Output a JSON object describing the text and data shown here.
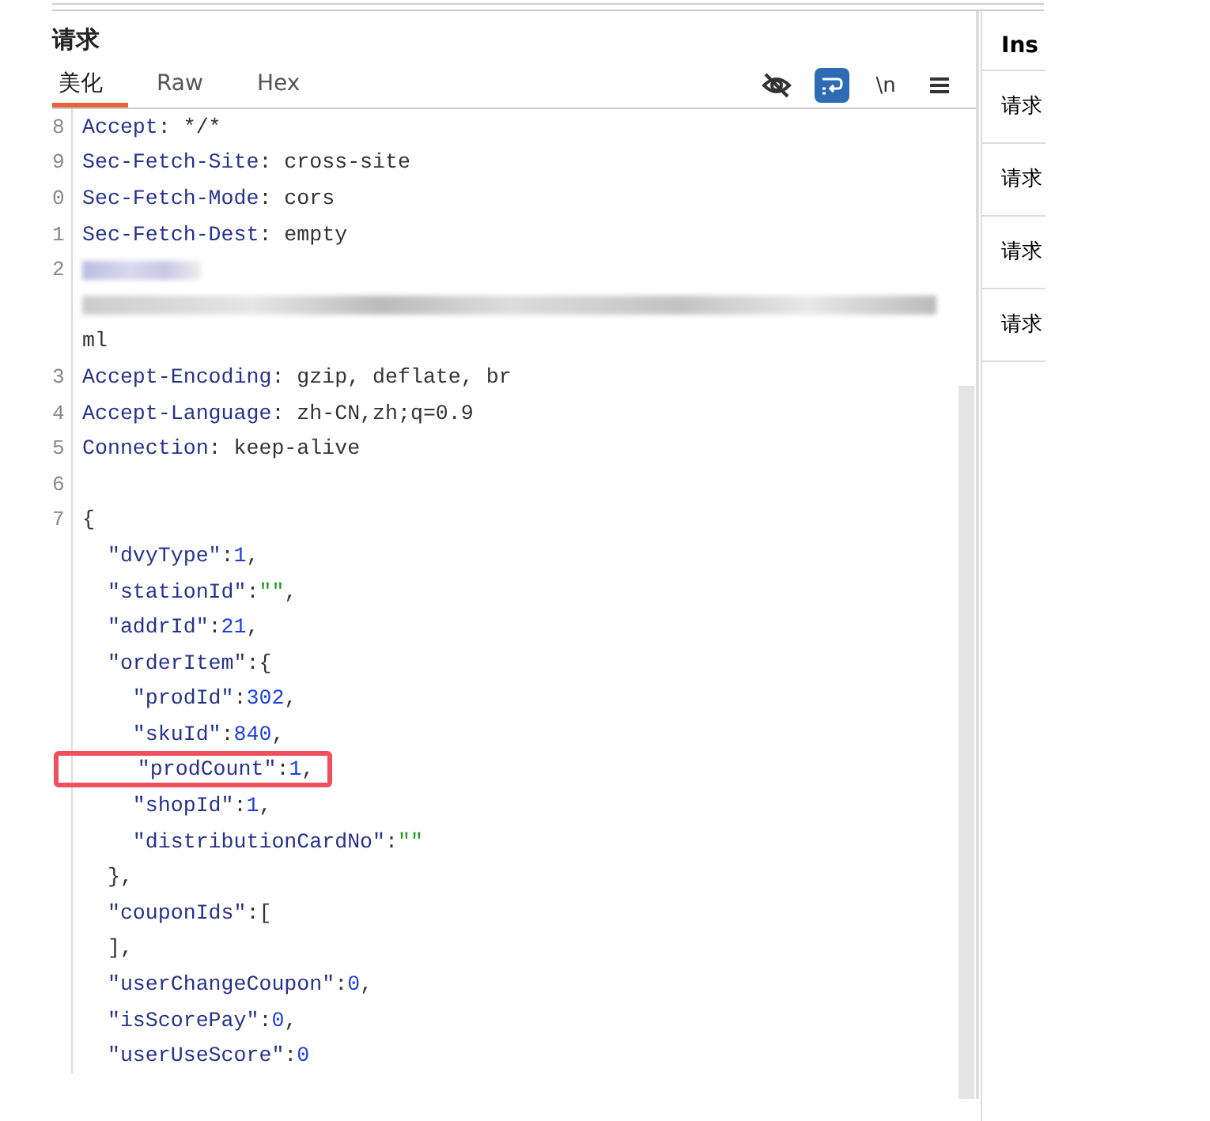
{
  "request_panel": {
    "title": "请求",
    "tabs": [
      {
        "label": "美化",
        "selected": true
      },
      {
        "label": "Raw",
        "selected": false
      },
      {
        "label": "Hex",
        "selected": false
      }
    ],
    "toolbar": [
      {
        "kind": "eye-off",
        "selected": false
      },
      {
        "kind": "wrap",
        "selected": true
      },
      {
        "kind": "text",
        "label": "\\n",
        "selected": false
      },
      {
        "kind": "menu",
        "selected": false
      }
    ],
    "lines": [
      {
        "number": "8",
        "tokens": [
          {
            "kind": "key",
            "text": "Accept"
          },
          {
            "kind": "plain",
            "text": ": */*"
          }
        ]
      },
      {
        "number": "9",
        "tokens": [
          {
            "kind": "key",
            "text": "Sec-Fetch-Site"
          },
          {
            "kind": "plain",
            "text": ": cross-site"
          }
        ]
      },
      {
        "number": "0",
        "tokens": [
          {
            "kind": "key",
            "text": "Sec-Fetch-Mode"
          },
          {
            "kind": "plain",
            "text": ": cors"
          }
        ]
      },
      {
        "number": "1",
        "tokens": [
          {
            "kind": "key",
            "text": "Sec-Fetch-Dest"
          },
          {
            "kind": "plain",
            "text": ": empty"
          }
        ]
      },
      {
        "number": "2",
        "kind": "redacted"
      },
      {
        "kind": "redacted-wide"
      },
      {
        "tokens": [
          {
            "kind": "plain",
            "text": "ml"
          }
        ]
      },
      {
        "number": "3",
        "tokens": [
          {
            "kind": "key",
            "text": "Accept-Encoding"
          },
          {
            "kind": "plain",
            "text": ": gzip, deflate, br"
          }
        ]
      },
      {
        "number": "4",
        "tokens": [
          {
            "kind": "key",
            "text": "Accept-Language"
          },
          {
            "kind": "plain",
            "text": ": zh-CN,zh;q=0.9"
          }
        ]
      },
      {
        "number": "5",
        "tokens": [
          {
            "kind": "key",
            "text": "Connection"
          },
          {
            "kind": "plain",
            "text": ": keep-alive"
          }
        ]
      },
      {
        "number": "6"
      },
      {
        "number": "7",
        "tokens": [
          {
            "kind": "punct",
            "text": "{"
          }
        ]
      },
      {
        "tokens": [
          {
            "kind": "key",
            "text": "  \"dvyType\""
          },
          {
            "kind": "punct",
            "text": ":"
          },
          {
            "kind": "number",
            "text": "1"
          },
          {
            "kind": "punct",
            "text": ","
          }
        ]
      },
      {
        "tokens": [
          {
            "kind": "key",
            "text": "  \"stationId\""
          },
          {
            "kind": "punct",
            "text": ":"
          },
          {
            "kind": "string",
            "text": "\"\""
          },
          {
            "kind": "punct",
            "text": ","
          }
        ]
      },
      {
        "tokens": [
          {
            "kind": "key",
            "text": "  \"addrId\""
          },
          {
            "kind": "punct",
            "text": ":"
          },
          {
            "kind": "number",
            "text": "21"
          },
          {
            "kind": "punct",
            "text": ","
          }
        ]
      },
      {
        "tokens": [
          {
            "kind": "key",
            "text": "  \"orderItem\""
          },
          {
            "kind": "punct",
            "text": ":{"
          }
        ]
      },
      {
        "tokens": [
          {
            "kind": "key",
            "text": "    \"prodId\""
          },
          {
            "kind": "punct",
            "text": ":"
          },
          {
            "kind": "number",
            "text": "302"
          },
          {
            "kind": "punct",
            "text": ","
          }
        ]
      },
      {
        "tokens": [
          {
            "kind": "key",
            "text": "    \"skuId\""
          },
          {
            "kind": "punct",
            "text": ":"
          },
          {
            "kind": "number",
            "text": "840"
          },
          {
            "kind": "punct",
            "text": ","
          }
        ]
      },
      {
        "highlighted": true,
        "tokens": [
          {
            "kind": "key",
            "text": "    \"prodCount\""
          },
          {
            "kind": "punct",
            "text": ":"
          },
          {
            "kind": "number",
            "text": "1"
          },
          {
            "kind": "punct",
            "text": ","
          }
        ]
      },
      {
        "tokens": [
          {
            "kind": "key",
            "text": "    \"shopId\""
          },
          {
            "kind": "punct",
            "text": ":"
          },
          {
            "kind": "number",
            "text": "1"
          },
          {
            "kind": "punct",
            "text": ","
          }
        ]
      },
      {
        "tokens": [
          {
            "kind": "key",
            "text": "    \"distributionCardNo\""
          },
          {
            "kind": "punct",
            "text": ":"
          },
          {
            "kind": "string",
            "text": "\"\""
          }
        ]
      },
      {
        "tokens": [
          {
            "kind": "punct",
            "text": "  },"
          }
        ]
      },
      {
        "tokens": [
          {
            "kind": "key",
            "text": "  \"couponIds\""
          },
          {
            "kind": "punct",
            "text": ":["
          }
        ]
      },
      {
        "tokens": [
          {
            "kind": "punct",
            "text": "  ],"
          }
        ]
      },
      {
        "tokens": [
          {
            "kind": "key",
            "text": "  \"userChangeCoupon\""
          },
          {
            "kind": "punct",
            "text": ":"
          },
          {
            "kind": "number",
            "text": "0"
          },
          {
            "kind": "punct",
            "text": ","
          }
        ]
      },
      {
        "tokens": [
          {
            "kind": "key",
            "text": "  \"isScorePay\""
          },
          {
            "kind": "punct",
            "text": ":"
          },
          {
            "kind": "number",
            "text": "0"
          },
          {
            "kind": "punct",
            "text": ","
          }
        ]
      },
      {
        "tokens": [
          {
            "kind": "key",
            "text": "  \"userUseScore\""
          },
          {
            "kind": "punct",
            "text": ":"
          },
          {
            "kind": "number",
            "text": "0"
          }
        ]
      }
    ]
  },
  "inspector": {
    "title": "Ins",
    "items": [
      "请求",
      "请求",
      "请求",
      "请求"
    ]
  }
}
